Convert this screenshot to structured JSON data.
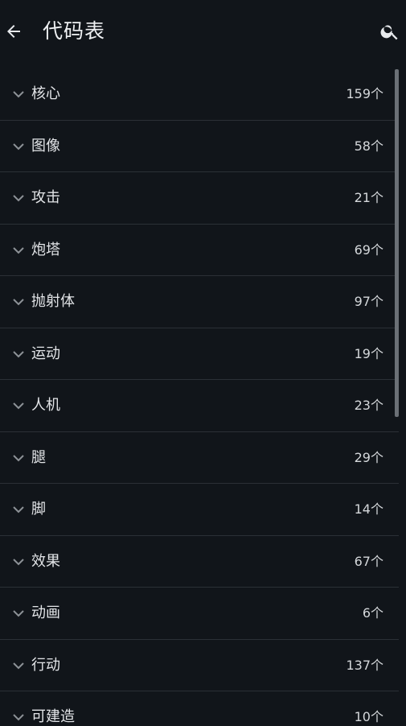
{
  "header": {
    "title": "代码表"
  },
  "categories": [
    {
      "label": "核心",
      "count": "159个"
    },
    {
      "label": "图像",
      "count": "58个"
    },
    {
      "label": "攻击",
      "count": "21个"
    },
    {
      "label": "炮塔",
      "count": "69个"
    },
    {
      "label": "抛射体",
      "count": "97个"
    },
    {
      "label": "运动",
      "count": "19个"
    },
    {
      "label": "人机",
      "count": "23个"
    },
    {
      "label": "腿",
      "count": "29个"
    },
    {
      "label": "脚",
      "count": "14个"
    },
    {
      "label": "效果",
      "count": "67个"
    },
    {
      "label": "动画",
      "count": "6个"
    },
    {
      "label": "行动",
      "count": "137个"
    },
    {
      "label": "可建造",
      "count": "10个"
    }
  ],
  "icons": {
    "back": "arrow-left-icon",
    "search": "search-icon",
    "expand": "chevron-down-icon"
  },
  "colors": {
    "background": "#11151a",
    "divider": "#2b3036",
    "text": "#e3e5e8",
    "scrollbar": "#6b7076"
  }
}
